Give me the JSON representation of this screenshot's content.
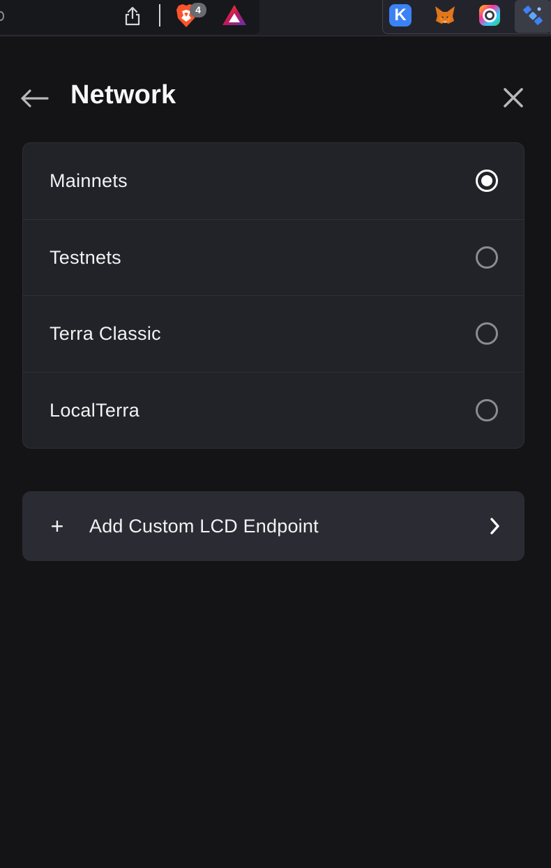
{
  "browser_toolbar": {
    "brave_shield_count": "4",
    "extensions": [
      {
        "name": "k-icon",
        "letter": "K"
      },
      {
        "name": "metamask-fox-icon"
      },
      {
        "name": "ring-camera-icon"
      },
      {
        "name": "satellite-icon"
      }
    ]
  },
  "header": {
    "title": "Network"
  },
  "networks": [
    {
      "label": "Mainnets",
      "selected": true
    },
    {
      "label": "Testnets",
      "selected": false
    },
    {
      "label": "Terra Classic",
      "selected": false
    },
    {
      "label": "LocalTerra",
      "selected": false
    }
  ],
  "add_custom": {
    "icon": "+",
    "label": "Add Custom LCD Endpoint"
  },
  "colors": {
    "background": "#141416",
    "card": "#222328",
    "add_card": "#2b2c33",
    "text": "#f2f2f4",
    "radio_unselected": "#8b8c93"
  }
}
